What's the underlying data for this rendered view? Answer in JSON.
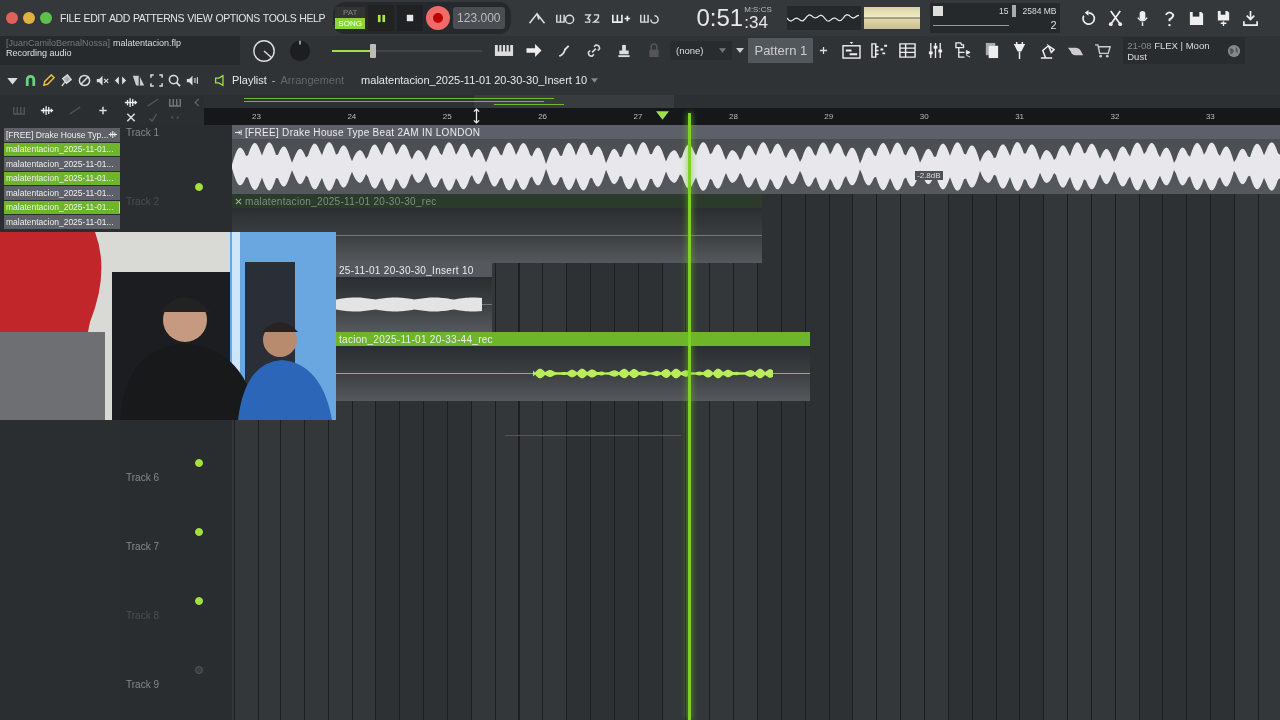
{
  "menu": [
    "FILE",
    "EDIT",
    "ADD",
    "PATTERNS",
    "VIEW",
    "OPTIONS",
    "TOOLS",
    "HELP"
  ],
  "transport": {
    "pat_label": "PAT",
    "song_label": "SONG",
    "song_selected": true,
    "playing": true,
    "recording": true,
    "tempo": "123.000"
  },
  "time": {
    "main": "0:51",
    "sub": ":34",
    "unit": "M:S:CS"
  },
  "cpu": {
    "polyphony": "15",
    "memory": "2584 MB",
    "count": "2"
  },
  "hint": {
    "user": "[JuanCamiloBernalNossa]",
    "file": "malatentacion.flp",
    "status": "Recording audio"
  },
  "master_volume": {
    "level": 0.27
  },
  "pattern": {
    "channel_filter": "(none)",
    "name": "Pattern 1"
  },
  "news": {
    "date": "21-08",
    "title": "FLEX | Moon Dust"
  },
  "playlist": {
    "title": "Playlist",
    "separator": "-",
    "subtitle": "Arrangement",
    "current_clip": "malatentacion_2025-11-01 20-30-30_Insert 10",
    "ruler": [
      "23",
      "24",
      "25",
      "26",
      "27",
      "28",
      "29",
      "30",
      "31",
      "32",
      "33"
    ],
    "clip_list": [
      {
        "label": "[FREE] Drake House Typ...",
        "selected": false,
        "marked": false
      },
      {
        "label": "malatentacion_2025-11-01...",
        "selected": true,
        "marked": false
      },
      {
        "label": "malatentacion_2025-11-01...",
        "selected": false,
        "marked": false
      },
      {
        "label": "malatentacion_2025-11-01...",
        "selected": true,
        "marked": false
      },
      {
        "label": "malatentacion_2025-11-01...",
        "selected": false,
        "marked": false
      },
      {
        "label": "malatentacion_2025-11-01...",
        "selected": true,
        "marked": true
      },
      {
        "label": "malatentacion_2025-11-01...",
        "selected": false,
        "marked": false
      }
    ],
    "tracks": [
      {
        "name": "Track 1",
        "dimmed": false,
        "dot_on": true
      },
      {
        "name": "Track 2",
        "dimmed": true
      },
      {
        "dot_on": true
      },
      {
        "name": "Track 6",
        "dimmed": false,
        "dot_on": true
      },
      {
        "name": "Track 7",
        "dimmed": false,
        "dot_on": true
      },
      {
        "name": "Track 8",
        "dimmed": true,
        "dot_on": false
      },
      {
        "name": "Track 9",
        "dimmed": false
      }
    ],
    "clips": [
      {
        "kind": "dense",
        "title": "[FREE] Drake House Type Beat 2AM IN LONDON",
        "color": "#5d6068",
        "gain_label": "-2.8dB",
        "muted": false
      },
      {
        "kind": "flat",
        "title": "malatentacion_2025-11-01 20-30-30_rec",
        "color": "#2c3a2c",
        "muted": true
      },
      {
        "kind": "blob",
        "title": "25-11-01 20-30-30_Insert 10",
        "color": "#55585e",
        "muted": false
      },
      {
        "kind": "sparse",
        "title": "tacion_2025-11-01 20-33-44_rec",
        "color": "#6fb52c",
        "muted": false
      }
    ]
  }
}
